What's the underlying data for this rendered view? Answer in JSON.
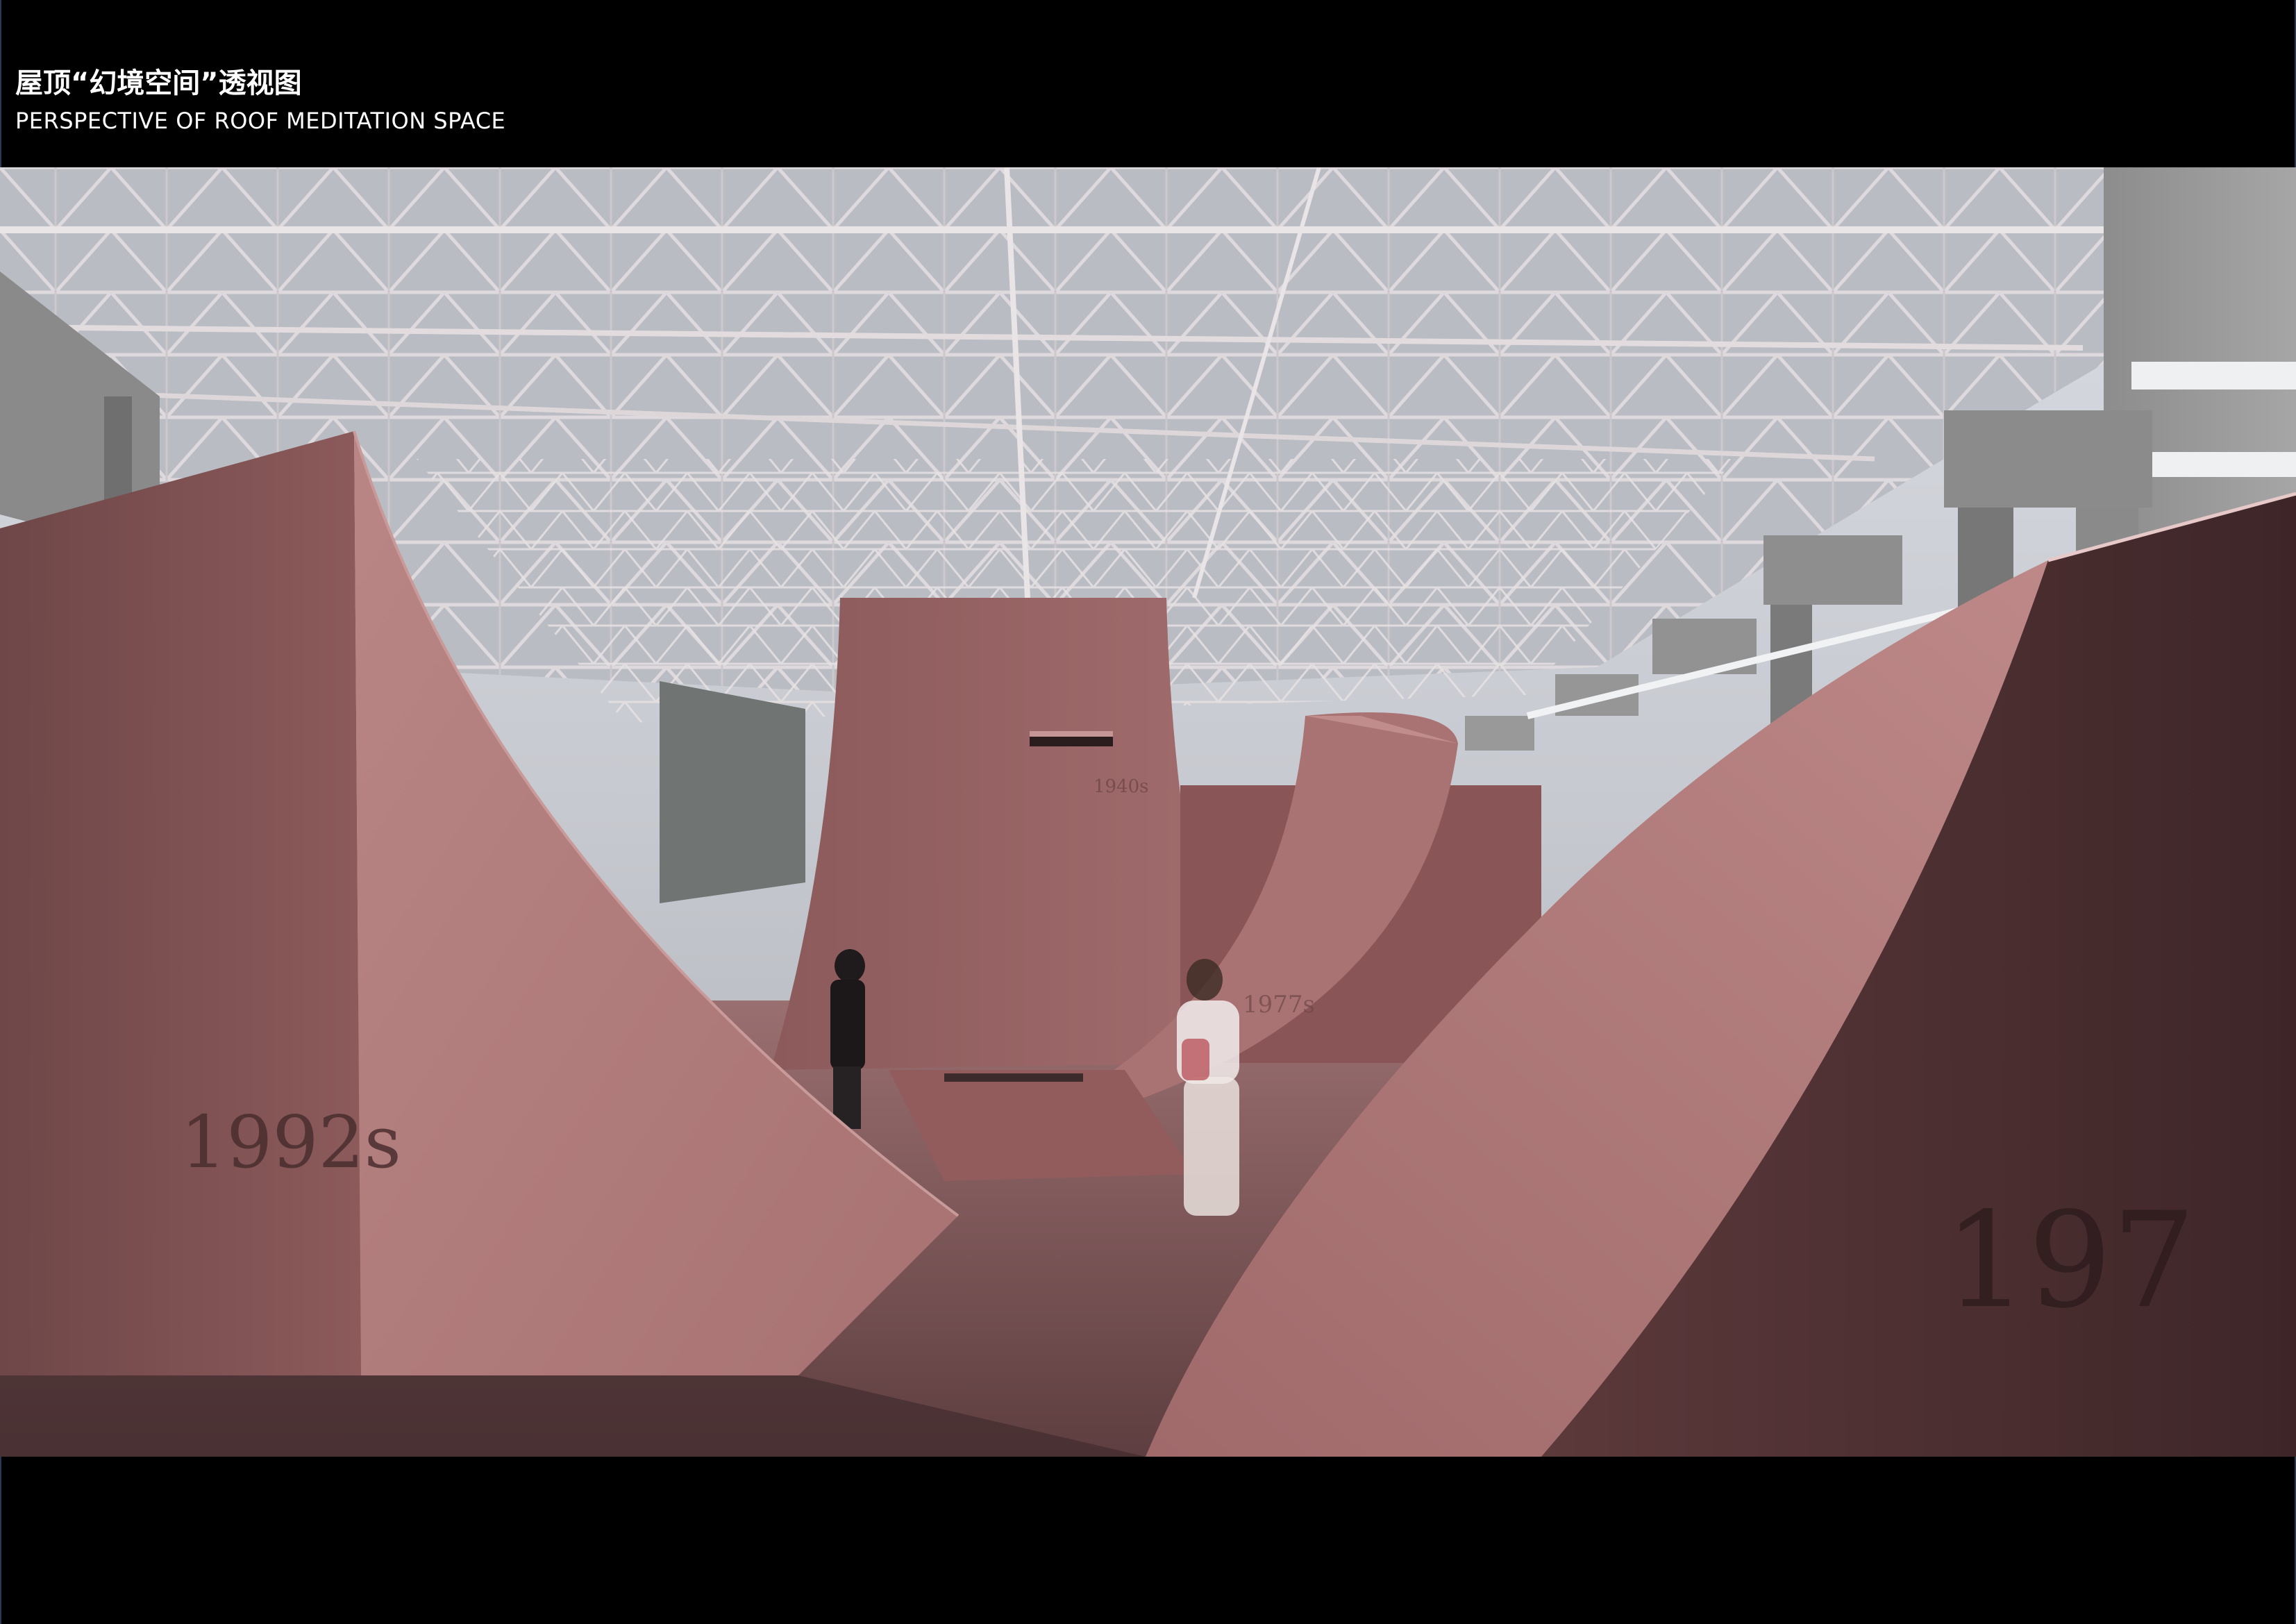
{
  "header": {
    "title_cn": "屋顶“幻境空间”透视图",
    "title_en": "PERSPECTIVE OF ROOF MEDITATION SPACE"
  },
  "render": {
    "engravings": {
      "left_block": "1992s",
      "center_tower": "1940s",
      "right_fin": "1977s",
      "right_block": "197"
    },
    "colors": {
      "background": "#000000",
      "title_text": "#ffffff",
      "sculpture": "#b07070",
      "sculpture_shadow": "#6e3f40",
      "truss": "#d9d3d6",
      "ceiling": "#9ea1a6",
      "concrete": "#8d8d8d"
    },
    "icons": [
      "space-truss",
      "concrete-columns",
      "curved-wall-sculpture",
      "visitor-figure"
    ]
  }
}
